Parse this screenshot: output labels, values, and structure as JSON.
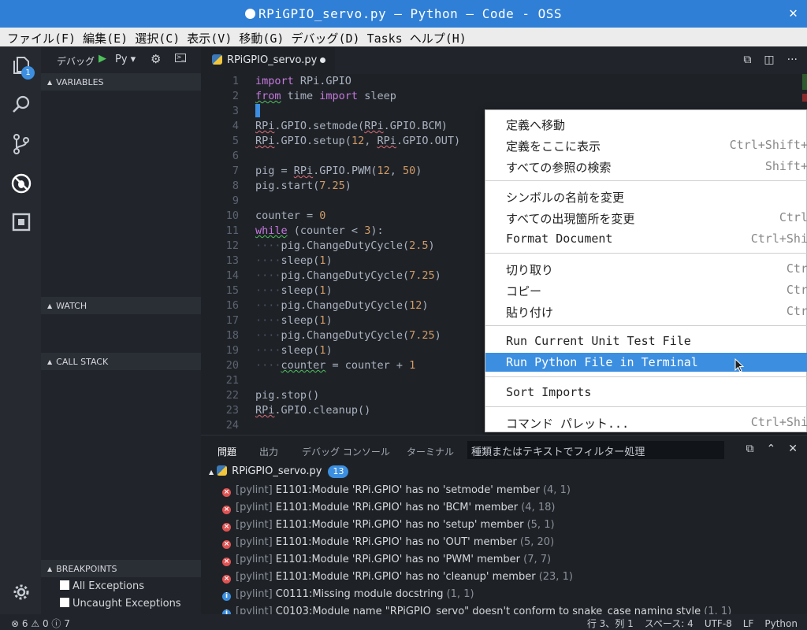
{
  "window": {
    "title": "RPiGPIO_servo.py — Python — Code - OSS"
  },
  "menu": [
    "ファイル(F)",
    "編集(E)",
    "選択(C)",
    "表示(V)",
    "移動(G)",
    "デバッグ(D)",
    "Tasks",
    "ヘルプ(H)"
  ],
  "activity": {
    "explorer_badge": "1"
  },
  "debug": {
    "label": "デバッグ",
    "config": "Py ▾"
  },
  "sidebar": {
    "variables": "VARIABLES",
    "watch": "WATCH",
    "callstack": "CALL STACK",
    "breakpoints": "BREAKPOINTS",
    "bp_items": [
      "All Exceptions",
      "Uncaught Exceptions"
    ]
  },
  "tab": {
    "label": "RPiGPIO_servo.py"
  },
  "editor": {
    "line_numbers": [
      "1",
      "2",
      "3",
      "4",
      "5",
      "6",
      "7",
      "8",
      "9",
      "10",
      "11",
      "12",
      "13",
      "14",
      "15",
      "16",
      "17",
      "18",
      "19",
      "20",
      "21",
      "22",
      "23",
      "24"
    ]
  },
  "context_menu": {
    "items": [
      {
        "label": "定義へ移動",
        "shortcut": ""
      },
      {
        "label": "定義をここに表示",
        "shortcut": "Ctrl+Shift+"
      },
      {
        "label": "すべての参照の検索",
        "shortcut": "Shift+"
      },
      {
        "label": "シンボルの名前を変更",
        "shortcut": ""
      },
      {
        "label": "すべての出現箇所を変更",
        "shortcut": "Ctrl"
      },
      {
        "label": "Format Document",
        "shortcut": "Ctrl+Shi"
      },
      {
        "label": "切り取り",
        "shortcut": "Ctr"
      },
      {
        "label": "コピー",
        "shortcut": "Ctr"
      },
      {
        "label": "貼り付け",
        "shortcut": "Ctr"
      },
      {
        "label": "Run Current Unit Test File",
        "shortcut": ""
      },
      {
        "label": "Run Python File in Terminal",
        "shortcut": ""
      },
      {
        "label": "Sort Imports",
        "shortcut": ""
      },
      {
        "label": "コマンド パレット...",
        "shortcut": "Ctrl+Shi"
      }
    ]
  },
  "panel": {
    "tabs": [
      "問題",
      "出力",
      "デバッグ コンソール",
      "ターミナル"
    ],
    "filter_placeholder": "種類またはテキストでフィルター処理",
    "file": "RPiGPIO_servo.py",
    "count": "13",
    "problems": [
      {
        "type": "error",
        "src": "[pylint]",
        "msg": "E1101:Module 'RPi.GPIO' has no 'setmode' member",
        "loc": "(4, 1)"
      },
      {
        "type": "error",
        "src": "[pylint]",
        "msg": "E1101:Module 'RPi.GPIO' has no 'BCM' member",
        "loc": "(4, 18)"
      },
      {
        "type": "error",
        "src": "[pylint]",
        "msg": "E1101:Module 'RPi.GPIO' has no 'setup' member",
        "loc": "(5, 1)"
      },
      {
        "type": "error",
        "src": "[pylint]",
        "msg": "E1101:Module 'RPi.GPIO' has no 'OUT' member",
        "loc": "(5, 20)"
      },
      {
        "type": "error",
        "src": "[pylint]",
        "msg": "E1101:Module 'RPi.GPIO' has no 'PWM' member",
        "loc": "(7, 7)"
      },
      {
        "type": "error",
        "src": "[pylint]",
        "msg": "E1101:Module 'RPi.GPIO' has no 'cleanup' member",
        "loc": "(23, 1)"
      },
      {
        "type": "info",
        "src": "[pylint]",
        "msg": "C0111:Missing module docstring",
        "loc": "(1, 1)"
      },
      {
        "type": "info",
        "src": "[pylint]",
        "msg": "C0103:Module name \"RPiGPIO_servo\" doesn't conform to snake_case naming style",
        "loc": "(1, 1)"
      }
    ]
  },
  "status": {
    "errors": "6",
    "warnings": "0",
    "infos": "7",
    "position": "行 3、列 1",
    "spaces": "スペース: 4",
    "encoding": "UTF-8",
    "eol": "LF",
    "language": "Python"
  }
}
